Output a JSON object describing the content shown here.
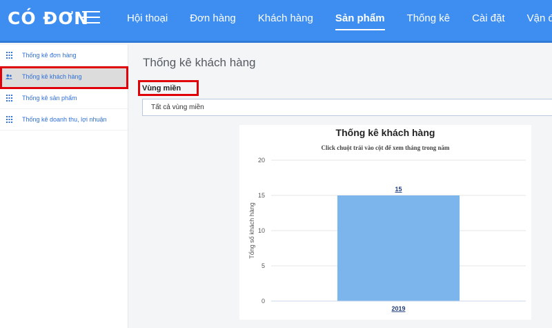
{
  "app": {
    "logo_text": "CÓ ĐƠN"
  },
  "nav": {
    "items": [
      {
        "label": "Hội thoại",
        "active": false
      },
      {
        "label": "Đơn hàng",
        "active": false
      },
      {
        "label": "Khách hàng",
        "active": false
      },
      {
        "label": "Sản phẩm",
        "active": true
      },
      {
        "label": "Thống kê",
        "active": false
      },
      {
        "label": "Cài đặt",
        "active": false
      },
      {
        "label": "Vận đơn",
        "active": false
      }
    ]
  },
  "sidebar": {
    "items": [
      {
        "label": "Thống kê đơn hàng",
        "icon": "grid-dots-icon",
        "active": false
      },
      {
        "label": "Thống kê khách hàng",
        "icon": "users-icon",
        "active": true
      },
      {
        "label": "Thống kê sản phẩm",
        "icon": "grid-dots-icon",
        "active": false
      },
      {
        "label": "Thống kê doanh thu, lợi nhuận",
        "icon": "grid-dots-icon",
        "active": false
      }
    ]
  },
  "main": {
    "title": "Thống kê khách hàng",
    "filter": {
      "label": "Vùng miền",
      "selected": "Tất cả vùng miền"
    }
  },
  "colors": {
    "topbar": "#3d8ef0",
    "bar": "#7cb5ec",
    "highlight": "#e0000a",
    "link": "#2e6fd8"
  },
  "chart_data": {
    "type": "bar",
    "title": "Thống kê khách hàng",
    "subtitle": "Click chuột trái vào cột để xem tháng trong năm",
    "ylabel": "Tổng số khách hàng",
    "xlabel": "",
    "categories": [
      "2019"
    ],
    "values": [
      15
    ],
    "ylim": [
      0,
      20
    ],
    "yticks": [
      0,
      5,
      10,
      15,
      20
    ],
    "grid": true
  }
}
